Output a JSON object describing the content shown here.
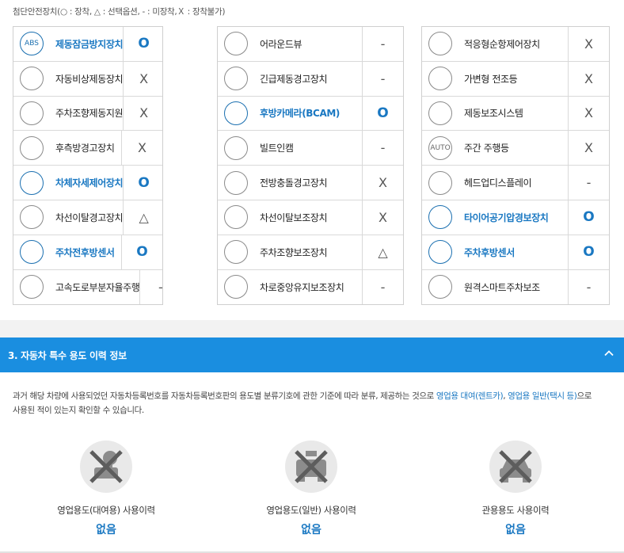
{
  "legend": "첨단안전장치(○ : 장착, △ : 선택옵션, - : 미장착,Ｘ : 장착불가)",
  "columns": [
    [
      {
        "icon": "abs-icon",
        "icon_text": "ABS",
        "label": "제동잠금방지장치",
        "status": "O",
        "on": true
      },
      {
        "icon": "emergency-brake-icon",
        "icon_text": "",
        "label": "자동비상제동장치",
        "status": "X",
        "on": false
      },
      {
        "icon": "parking-steer-icon",
        "icon_text": "",
        "label": "주차조향제동지원",
        "status": "X",
        "on": false
      },
      {
        "icon": "rear-cross-alert-icon",
        "icon_text": "",
        "label": "후측방경고장치",
        "status": "X",
        "on": false
      },
      {
        "icon": "stability-control-icon",
        "icon_text": "",
        "label": "차체자세제어장치",
        "status": "O",
        "on": true
      },
      {
        "icon": "lane-departure-warning-icon",
        "icon_text": "",
        "label": "차선이탈경고장치",
        "status": "△",
        "on": false
      },
      {
        "icon": "parking-sensor-icon",
        "icon_text": "",
        "label": "주차전후방센서",
        "status": "O",
        "on": true
      },
      {
        "icon": "highway-driving-assist-icon",
        "icon_text": "",
        "label": "고속도로부분자율주행",
        "status": "-",
        "on": false
      }
    ],
    [
      {
        "icon": "around-view-icon",
        "icon_text": "",
        "label": "어라운드뷰",
        "status": "-",
        "on": false
      },
      {
        "icon": "emergency-brake-warning-icon",
        "icon_text": "",
        "label": "긴급제동경고장치",
        "status": "-",
        "on": false
      },
      {
        "icon": "rear-camera-icon",
        "icon_text": "",
        "label": "후방카메라(BCAM)",
        "status": "O",
        "on": true
      },
      {
        "icon": "builtin-cam-icon",
        "icon_text": "",
        "label": "빌트인캠",
        "status": "-",
        "on": false
      },
      {
        "icon": "forward-collision-icon",
        "icon_text": "",
        "label": "전방충돌경고장치",
        "status": "X",
        "on": false
      },
      {
        "icon": "lane-keeping-icon",
        "icon_text": "",
        "label": "차선이탈보조장치",
        "status": "X",
        "on": false
      },
      {
        "icon": "parking-assist-icon",
        "icon_text": "",
        "label": "주차조향보조장치",
        "status": "△",
        "on": false
      },
      {
        "icon": "lane-centering-icon",
        "icon_text": "",
        "label": "차로중앙유지보조장치",
        "status": "-",
        "on": false
      }
    ],
    [
      {
        "icon": "adaptive-cruise-icon",
        "icon_text": "",
        "label": "적응형순항제어장치",
        "status": "X",
        "on": false
      },
      {
        "icon": "adaptive-headlight-icon",
        "icon_text": "",
        "label": "가변형 전조등",
        "status": "X",
        "on": false
      },
      {
        "icon": "brake-assist-icon",
        "icon_text": "",
        "label": "제동보조시스템",
        "status": "X",
        "on": false
      },
      {
        "icon": "daytime-running-light-icon",
        "icon_text": "AUTO",
        "label": "주간 주행등",
        "status": "X",
        "on": false
      },
      {
        "icon": "head-up-display-icon",
        "icon_text": "",
        "label": "헤드업디스플레이",
        "status": "-",
        "on": false
      },
      {
        "icon": "tire-pressure-icon",
        "icon_text": "",
        "label": "타이어공기압경보장치",
        "status": "O",
        "on": true
      },
      {
        "icon": "rear-sensor-icon",
        "icon_text": "",
        "label": "주차후방센서",
        "status": "O",
        "on": true
      },
      {
        "icon": "remote-smart-parking-icon",
        "icon_text": "",
        "label": "원격스마트주차보조",
        "status": "-",
        "on": false
      }
    ]
  ],
  "section3": {
    "title": "3. 자동차 특수 용도 이력 정보",
    "desc_part1": "과거 해당 차량에 사용되었던 자동차등록번호를 자동차등록번호판의 용도별 분류기호에 관한 기준에 따라 분류, 제공하는 것으로 ",
    "desc_hl1": "영업용 대여(렌트카)",
    "desc_sep": ", ",
    "desc_hl2": "영업용 일반(택시 등)",
    "desc_part2": "으로",
    "desc_line2": "사용된 적이 있는지 확인할 수 있습니다.",
    "usages": [
      {
        "label": "영업용도(대여용) 사용이력",
        "value": "없음"
      },
      {
        "label": "영업용도(일반) 사용이력",
        "value": "없음"
      },
      {
        "label": "관용용도 사용이력",
        "value": "없음"
      }
    ]
  },
  "colors": {
    "accent": "#1a8ee0",
    "on_text": "#1a78c2"
  }
}
